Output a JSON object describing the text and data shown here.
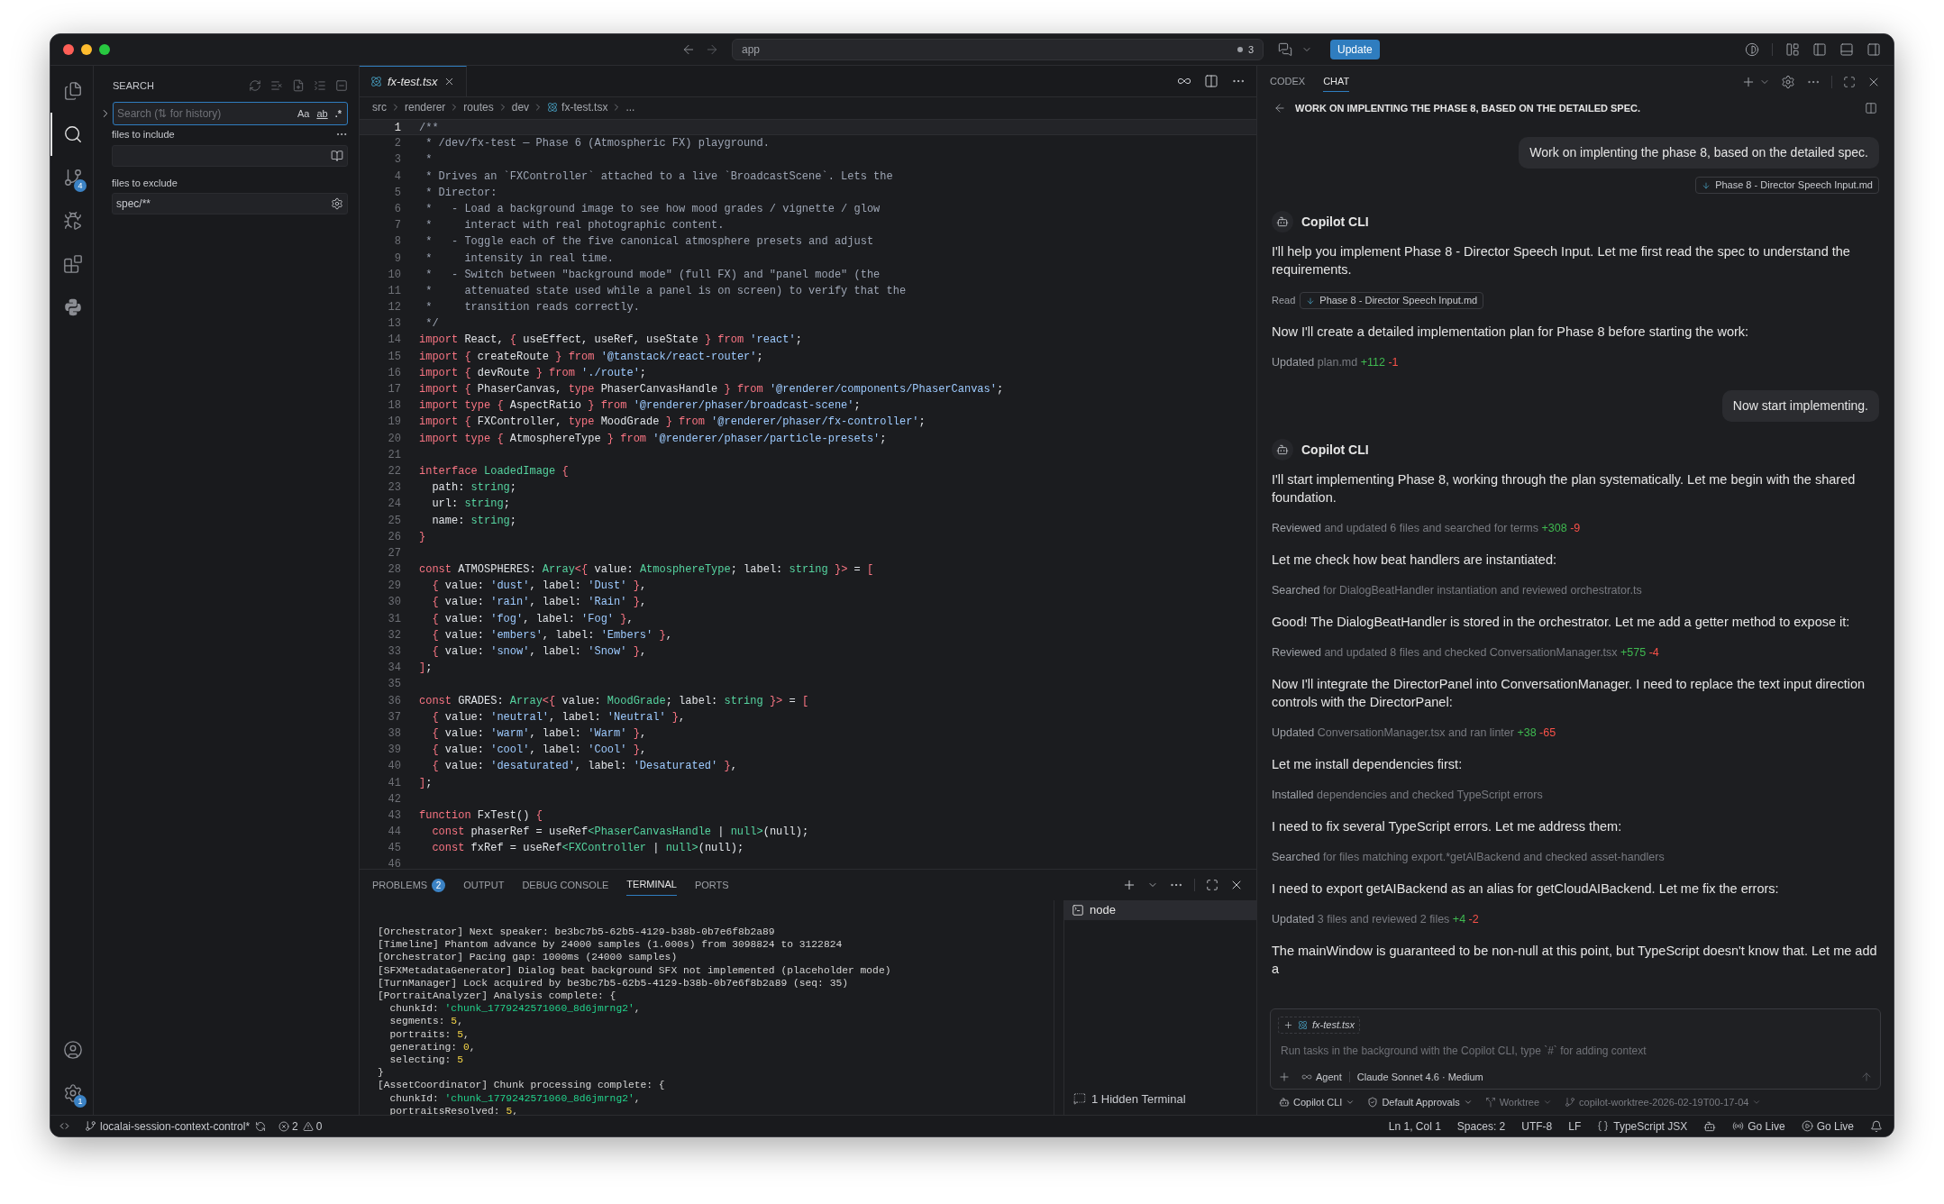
{
  "title_bar": {
    "command_center": "app",
    "notifications": "3",
    "update_button": "Update"
  },
  "activity_bar": {
    "items": [
      {
        "kind": "files",
        "selected": false
      },
      {
        "kind": "search",
        "selected": true
      },
      {
        "kind": "source_control",
        "selected": false,
        "badge": "4"
      },
      {
        "kind": "run_debug",
        "selected": false
      },
      {
        "kind": "extensions",
        "selected": false
      },
      {
        "kind": "python",
        "selected": false
      }
    ],
    "bottom": [
      {
        "kind": "accounts"
      },
      {
        "kind": "settings",
        "badge": "1"
      }
    ]
  },
  "sidebar": {
    "title": "SEARCH",
    "search": {
      "placeholder": "Search (⇅ for history)",
      "options": [
        {
          "label": "Aa",
          "kind": "case",
          "selected": false
        },
        {
          "label": "ab",
          "kind": "word",
          "selected": false
        },
        {
          "label": ".*",
          "kind": "regex",
          "selected": false
        }
      ]
    },
    "include": {
      "label": "files to include"
    },
    "exclude": {
      "label": "files to exclude",
      "value": "spec/**"
    }
  },
  "editor": {
    "tabs": [
      {
        "label": "fx-test.tsx",
        "selected": true,
        "preview": true
      }
    ],
    "breadcrumbs": [
      {
        "text": "src",
        "kind": "folder"
      },
      {
        "text": "renderer",
        "kind": "folder"
      },
      {
        "text": "routes",
        "kind": "folder"
      },
      {
        "text": "dev",
        "kind": "folder"
      },
      {
        "text": "fx-test.tsx",
        "kind": "file"
      },
      {
        "text": "...",
        "kind": "more"
      }
    ],
    "lines": [
      {
        "no": "1",
        "current": true,
        "tokens": [
          {
            "kind": "comment",
            "text": "/**"
          }
        ]
      },
      {
        "no": "2",
        "current": false,
        "tokens": [
          {
            "kind": "comment",
            "text": " * /dev/fx-test — Phase 6 (Atmospheric FX) playground."
          }
        ]
      },
      {
        "no": "3",
        "current": false,
        "tokens": [
          {
            "kind": "comment",
            "text": " *"
          }
        ]
      },
      {
        "no": "4",
        "current": false,
        "tokens": [
          {
            "kind": "comment",
            "text": " * Drives an `FXController` attached to a live `BroadcastScene`. Lets the"
          }
        ]
      },
      {
        "no": "5",
        "current": false,
        "tokens": [
          {
            "kind": "comment",
            "text": " * Director:"
          }
        ]
      },
      {
        "no": "6",
        "current": false,
        "tokens": [
          {
            "kind": "comment",
            "text": " *   - Load a background image to see how mood grades / vignette / glow"
          }
        ]
      },
      {
        "no": "7",
        "current": false,
        "tokens": [
          {
            "kind": "comment",
            "text": " *     interact with real photographic content."
          }
        ]
      },
      {
        "no": "8",
        "current": false,
        "tokens": [
          {
            "kind": "comment",
            "text": " *   - Toggle each of the five canonical atmosphere presets and adjust"
          }
        ]
      },
      {
        "no": "9",
        "current": false,
        "tokens": [
          {
            "kind": "comment",
            "text": " *     intensity in real time."
          }
        ]
      },
      {
        "no": "10",
        "current": false,
        "tokens": [
          {
            "kind": "comment",
            "text": " *   - Switch between \"background mode\" (full FX) and \"panel mode\" (the"
          }
        ]
      },
      {
        "no": "11",
        "current": false,
        "tokens": [
          {
            "kind": "comment",
            "text": " *     attenuated state used while a panel is on screen) to verify that the"
          }
        ]
      },
      {
        "no": "12",
        "current": false,
        "tokens": [
          {
            "kind": "comment",
            "text": " *     transition reads correctly."
          }
        ]
      },
      {
        "no": "13",
        "current": false,
        "tokens": [
          {
            "kind": "comment",
            "text": " */"
          }
        ]
      },
      {
        "no": "14",
        "current": false,
        "tokens": [
          {
            "kind": "keyword",
            "text": "import"
          },
          {
            "kind": "plain",
            "text": " React, "
          },
          {
            "kind": "keyword",
            "text": "{"
          },
          {
            "kind": "plain",
            "text": " useEffect, useRef, useState "
          },
          {
            "kind": "keyword",
            "text": "} from "
          },
          {
            "kind": "string",
            "text": "'react'"
          },
          {
            "kind": "plain",
            "text": ";"
          }
        ]
      },
      {
        "no": "15",
        "current": false,
        "tokens": [
          {
            "kind": "keyword",
            "text": "import {"
          },
          {
            "kind": "plain",
            "text": " createRoute "
          },
          {
            "kind": "keyword",
            "text": "} from "
          },
          {
            "kind": "string",
            "text": "'@tanstack/react-router'"
          },
          {
            "kind": "plain",
            "text": ";"
          }
        ]
      },
      {
        "no": "16",
        "current": false,
        "tokens": [
          {
            "kind": "keyword",
            "text": "import {"
          },
          {
            "kind": "plain",
            "text": " devRoute "
          },
          {
            "kind": "keyword",
            "text": "} from "
          },
          {
            "kind": "string",
            "text": "'./route'"
          },
          {
            "kind": "plain",
            "text": ";"
          }
        ]
      },
      {
        "no": "17",
        "current": false,
        "tokens": [
          {
            "kind": "keyword",
            "text": "import {"
          },
          {
            "kind": "plain",
            "text": " PhaserCanvas, "
          },
          {
            "kind": "keyword",
            "text": "type"
          },
          {
            "kind": "plain",
            "text": " PhaserCanvasHandle "
          },
          {
            "kind": "keyword",
            "text": "} from "
          },
          {
            "kind": "string",
            "text": "'@renderer/components/PhaserCanvas'"
          },
          {
            "kind": "plain",
            "text": ";"
          }
        ]
      },
      {
        "no": "18",
        "current": false,
        "tokens": [
          {
            "kind": "keyword",
            "text": "import type {"
          },
          {
            "kind": "plain",
            "text": " AspectRatio "
          },
          {
            "kind": "keyword",
            "text": "} from "
          },
          {
            "kind": "string",
            "text": "'@renderer/phaser/broadcast-scene'"
          },
          {
            "kind": "plain",
            "text": ";"
          }
        ]
      },
      {
        "no": "19",
        "current": false,
        "tokens": [
          {
            "kind": "keyword",
            "text": "import {"
          },
          {
            "kind": "plain",
            "text": " FXController, "
          },
          {
            "kind": "keyword",
            "text": "type"
          },
          {
            "kind": "plain",
            "text": " MoodGrade "
          },
          {
            "kind": "keyword",
            "text": "} from "
          },
          {
            "kind": "string",
            "text": "'@renderer/phaser/fx-controller'"
          },
          {
            "kind": "plain",
            "text": ";"
          }
        ]
      },
      {
        "no": "20",
        "current": false,
        "tokens": [
          {
            "kind": "keyword",
            "text": "import type {"
          },
          {
            "kind": "plain",
            "text": " AtmosphereType "
          },
          {
            "kind": "keyword",
            "text": "} from "
          },
          {
            "kind": "string",
            "text": "'@renderer/phaser/particle-presets'"
          },
          {
            "kind": "plain",
            "text": ";"
          }
        ]
      },
      {
        "no": "21",
        "current": false
      },
      {
        "no": "22",
        "current": false,
        "tokens": [
          {
            "kind": "keyword",
            "text": "interface "
          },
          {
            "kind": "type",
            "text": "LoadedImage"
          },
          {
            "kind": "keyword",
            "text": " {"
          }
        ]
      },
      {
        "no": "23",
        "current": false,
        "tokens": [
          {
            "kind": "plain",
            "text": "  path: "
          },
          {
            "kind": "type",
            "text": "string"
          },
          {
            "kind": "plain",
            "text": ";"
          }
        ]
      },
      {
        "no": "24",
        "current": false,
        "tokens": [
          {
            "kind": "plain",
            "text": "  url: "
          },
          {
            "kind": "type",
            "text": "string"
          },
          {
            "kind": "plain",
            "text": ";"
          }
        ]
      },
      {
        "no": "25",
        "current": false,
        "tokens": [
          {
            "kind": "plain",
            "text": "  name: "
          },
          {
            "kind": "type",
            "text": "string"
          },
          {
            "kind": "plain",
            "text": ";"
          }
        ]
      },
      {
        "no": "26",
        "current": false,
        "tokens": [
          {
            "kind": "keyword",
            "text": "}"
          }
        ]
      },
      {
        "no": "27",
        "current": false
      },
      {
        "no": "28",
        "current": false,
        "tokens": [
          {
            "kind": "keyword",
            "text": "const "
          },
          {
            "kind": "plain",
            "text": "ATMOSPHERES: "
          },
          {
            "kind": "type",
            "text": "Array"
          },
          {
            "kind": "keyword",
            "text": "<{"
          },
          {
            "kind": "plain",
            "text": " value: "
          },
          {
            "kind": "type",
            "text": "AtmosphereType"
          },
          {
            "kind": "plain",
            "text": "; label: "
          },
          {
            "kind": "type",
            "text": "string"
          },
          {
            "kind": "keyword",
            "text": " }>"
          },
          {
            "kind": "plain",
            "text": " = "
          },
          {
            "kind": "keyword",
            "text": "["
          }
        ]
      },
      {
        "no": "29",
        "current": false,
        "tokens": [
          {
            "kind": "keyword",
            "text": "  {"
          },
          {
            "kind": "plain",
            "text": " value: "
          },
          {
            "kind": "string",
            "text": "'dust'"
          },
          {
            "kind": "plain",
            "text": ", label: "
          },
          {
            "kind": "string",
            "text": "'Dust'"
          },
          {
            "kind": "keyword",
            "text": " }"
          },
          {
            "kind": "plain",
            "text": ","
          }
        ]
      },
      {
        "no": "30",
        "current": false,
        "tokens": [
          {
            "kind": "keyword",
            "text": "  {"
          },
          {
            "kind": "plain",
            "text": " value: "
          },
          {
            "kind": "string",
            "text": "'rain'"
          },
          {
            "kind": "plain",
            "text": ", label: "
          },
          {
            "kind": "string",
            "text": "'Rain'"
          },
          {
            "kind": "keyword",
            "text": " }"
          },
          {
            "kind": "plain",
            "text": ","
          }
        ]
      },
      {
        "no": "31",
        "current": false,
        "tokens": [
          {
            "kind": "keyword",
            "text": "  {"
          },
          {
            "kind": "plain",
            "text": " value: "
          },
          {
            "kind": "string",
            "text": "'fog'"
          },
          {
            "kind": "plain",
            "text": ", label: "
          },
          {
            "kind": "string",
            "text": "'Fog'"
          },
          {
            "kind": "keyword",
            "text": " }"
          },
          {
            "kind": "plain",
            "text": ","
          }
        ]
      },
      {
        "no": "32",
        "current": false,
        "tokens": [
          {
            "kind": "keyword",
            "text": "  {"
          },
          {
            "kind": "plain",
            "text": " value: "
          },
          {
            "kind": "string",
            "text": "'embers'"
          },
          {
            "kind": "plain",
            "text": ", label: "
          },
          {
            "kind": "string",
            "text": "'Embers'"
          },
          {
            "kind": "keyword",
            "text": " }"
          },
          {
            "kind": "plain",
            "text": ","
          }
        ]
      },
      {
        "no": "33",
        "current": false,
        "tokens": [
          {
            "kind": "keyword",
            "text": "  {"
          },
          {
            "kind": "plain",
            "text": " value: "
          },
          {
            "kind": "string",
            "text": "'snow'"
          },
          {
            "kind": "plain",
            "text": ", label: "
          },
          {
            "kind": "string",
            "text": "'Snow'"
          },
          {
            "kind": "keyword",
            "text": " }"
          },
          {
            "kind": "plain",
            "text": ","
          }
        ]
      },
      {
        "no": "34",
        "current": false,
        "tokens": [
          {
            "kind": "keyword",
            "text": "]"
          },
          {
            "kind": "plain",
            "text": ";"
          }
        ]
      },
      {
        "no": "35",
        "current": false
      },
      {
        "no": "36",
        "current": false,
        "tokens": [
          {
            "kind": "keyword",
            "text": "const "
          },
          {
            "kind": "plain",
            "text": "GRADES: "
          },
          {
            "kind": "type",
            "text": "Array"
          },
          {
            "kind": "keyword",
            "text": "<{"
          },
          {
            "kind": "plain",
            "text": " value: "
          },
          {
            "kind": "type",
            "text": "MoodGrade"
          },
          {
            "kind": "plain",
            "text": "; label: "
          },
          {
            "kind": "type",
            "text": "string"
          },
          {
            "kind": "keyword",
            "text": " }>"
          },
          {
            "kind": "plain",
            "text": " = "
          },
          {
            "kind": "keyword",
            "text": "["
          }
        ]
      },
      {
        "no": "37",
        "current": false,
        "tokens": [
          {
            "kind": "keyword",
            "text": "  {"
          },
          {
            "kind": "plain",
            "text": " value: "
          },
          {
            "kind": "string",
            "text": "'neutral'"
          },
          {
            "kind": "plain",
            "text": ", label: "
          },
          {
            "kind": "string",
            "text": "'Neutral'"
          },
          {
            "kind": "keyword",
            "text": " }"
          },
          {
            "kind": "plain",
            "text": ","
          }
        ]
      },
      {
        "no": "38",
        "current": false,
        "tokens": [
          {
            "kind": "keyword",
            "text": "  {"
          },
          {
            "kind": "plain",
            "text": " value: "
          },
          {
            "kind": "string",
            "text": "'warm'"
          },
          {
            "kind": "plain",
            "text": ", label: "
          },
          {
            "kind": "string",
            "text": "'Warm'"
          },
          {
            "kind": "keyword",
            "text": " }"
          },
          {
            "kind": "plain",
            "text": ","
          }
        ]
      },
      {
        "no": "39",
        "current": false,
        "tokens": [
          {
            "kind": "keyword",
            "text": "  {"
          },
          {
            "kind": "plain",
            "text": " value: "
          },
          {
            "kind": "string",
            "text": "'cool'"
          },
          {
            "kind": "plain",
            "text": ", label: "
          },
          {
            "kind": "string",
            "text": "'Cool'"
          },
          {
            "kind": "keyword",
            "text": " }"
          },
          {
            "kind": "plain",
            "text": ","
          }
        ]
      },
      {
        "no": "40",
        "current": false,
        "tokens": [
          {
            "kind": "keyword",
            "text": "  {"
          },
          {
            "kind": "plain",
            "text": " value: "
          },
          {
            "kind": "string",
            "text": "'desaturated'"
          },
          {
            "kind": "plain",
            "text": ", label: "
          },
          {
            "kind": "string",
            "text": "'Desaturated'"
          },
          {
            "kind": "keyword",
            "text": " }"
          },
          {
            "kind": "plain",
            "text": ","
          }
        ]
      },
      {
        "no": "41",
        "current": false,
        "tokens": [
          {
            "kind": "keyword",
            "text": "]"
          },
          {
            "kind": "plain",
            "text": ";"
          }
        ]
      },
      {
        "no": "42",
        "current": false
      },
      {
        "no": "43",
        "current": false,
        "tokens": [
          {
            "kind": "keyword",
            "text": "function "
          },
          {
            "kind": "plain",
            "text": "FxTest() "
          },
          {
            "kind": "keyword",
            "text": "{"
          }
        ]
      },
      {
        "no": "44",
        "current": false,
        "tokens": [
          {
            "kind": "keyword",
            "text": "  const "
          },
          {
            "kind": "plain",
            "text": "phaserRef = useRef"
          },
          {
            "kind": "type",
            "text": "<PhaserCanvasHandle"
          },
          {
            "kind": "plain",
            "text": " | "
          },
          {
            "kind": "type",
            "text": "null>"
          },
          {
            "kind": "plain",
            "text": "(null);"
          }
        ]
      },
      {
        "no": "45",
        "current": false,
        "tokens": [
          {
            "kind": "keyword",
            "text": "  const "
          },
          {
            "kind": "plain",
            "text": "fxRef = useRef"
          },
          {
            "kind": "type",
            "text": "<FXController"
          },
          {
            "kind": "plain",
            "text": " | "
          },
          {
            "kind": "type",
            "text": "null>"
          },
          {
            "kind": "plain",
            "text": "(null);"
          }
        ]
      },
      {
        "no": "46",
        "current": false
      }
    ]
  },
  "panel": {
    "tabs": [
      {
        "label": "PROBLEMS",
        "selected": false,
        "badge": "2"
      },
      {
        "label": "OUTPUT",
        "selected": false
      },
      {
        "label": "DEBUG CONSOLE",
        "selected": false
      },
      {
        "label": "TERMINAL",
        "selected": true
      },
      {
        "label": "PORTS",
        "selected": false
      }
    ],
    "terminal": {
      "lines": [
        [
          {
            "kind": "plain",
            "text": "[Orchestrator] Next speaker: be3bc7b5-62b5-4129-b38b-0b7e6f8b2a89"
          }
        ],
        [
          {
            "kind": "plain",
            "text": "[Timeline] Phantom advance by 24000 samples (1.000s) from 3098824 to 3122824"
          }
        ],
        [
          {
            "kind": "plain",
            "text": "[Orchestrator] Pacing gap: 1000ms (24000 samples)"
          }
        ],
        [
          {
            "kind": "plain",
            "text": "[SFXMetadataGenerator] Dialog beat background SFX not implemented (placeholder mode)"
          }
        ],
        [
          {
            "kind": "plain",
            "text": "[TurnManager] Lock acquired by be3bc7b5-62b5-4129-b38b-0b7e6f8b2a89 (seq: 35)"
          }
        ],
        [
          {
            "kind": "plain",
            "text": "[PortraitAnalyzer] Analysis complete: {"
          }
        ],
        [
          {
            "kind": "plain",
            "text": "  chunkId: "
          },
          {
            "kind": "string",
            "text": "'chunk_1779242571060_8d6jmrng2'"
          },
          {
            "kind": "plain",
            "text": ","
          }
        ],
        [
          {
            "kind": "plain",
            "text": "  segments: "
          },
          {
            "kind": "number",
            "text": "5"
          },
          {
            "kind": "plain",
            "text": ","
          }
        ],
        [
          {
            "kind": "plain",
            "text": "  portraits: "
          },
          {
            "kind": "number",
            "text": "5"
          },
          {
            "kind": "plain",
            "text": ","
          }
        ],
        [
          {
            "kind": "plain",
            "text": "  generating: "
          },
          {
            "kind": "number",
            "text": "0"
          },
          {
            "kind": "plain",
            "text": ","
          }
        ],
        [
          {
            "kind": "plain",
            "text": "  selecting: "
          },
          {
            "kind": "number",
            "text": "5"
          }
        ],
        [
          {
            "kind": "plain",
            "text": "}"
          }
        ],
        [
          {
            "kind": "plain",
            "text": "[AssetCoordinator] Chunk processing complete: {"
          }
        ],
        [
          {
            "kind": "plain",
            "text": "  chunkId: "
          },
          {
            "kind": "string",
            "text": "'chunk_1779242571060_8d6jmrng2'"
          },
          {
            "kind": "plain",
            "text": ","
          }
        ],
        [
          {
            "kind": "plain",
            "text": "  portraitsResolved: "
          },
          {
            "kind": "number",
            "text": "5"
          },
          {
            "kind": "plain",
            "text": ","
          }
        ]
      ]
    },
    "terminals": [
      {
        "label": "node",
        "selected": true
      }
    ],
    "hidden_terminals": "1 Hidden Terminal"
  },
  "chat": {
    "tabs": [
      {
        "label": "CODEX",
        "selected": false
      },
      {
        "label": "CHAT",
        "selected": true
      }
    ],
    "title": "WORK ON IMPLENTING THE PHASE 8, BASED ON THE DETAILED SPEC.",
    "items": [
      {
        "kind": "user",
        "text": "Work on implenting the phase 8, based on the detailed spec."
      },
      {
        "kind": "attachment",
        "text": "Phase 8 - Director Speech Input.md"
      },
      {
        "kind": "agent",
        "text": "Copilot CLI"
      },
      {
        "kind": "text",
        "text": "I'll help you implement Phase 8 - Director Speech Input. Let me first read the spec to understand the requirements."
      },
      {
        "kind": "read",
        "verb": "Read",
        "text": "Phase 8 - Director Speech Input.md"
      },
      {
        "kind": "text",
        "text": "Now I'll create a detailed implementation plan for Phase 8 before starting the work:"
      },
      {
        "kind": "action",
        "verb": "Updated",
        "text": "plan.md",
        "added": "+112",
        "removed": "-1"
      },
      {
        "kind": "user",
        "text": "Now start implementing."
      },
      {
        "kind": "agent",
        "text": "Copilot CLI"
      },
      {
        "kind": "text",
        "text": "I'll start implementing Phase 8, working through the plan systematically. Let me begin with the shared foundation."
      },
      {
        "kind": "action",
        "verb": "Reviewed",
        "text": "and updated 6 files and searched for terms",
        "added": "+308",
        "removed": "-9"
      },
      {
        "kind": "text",
        "text": "Let me check how beat handlers are instantiated:"
      },
      {
        "kind": "action",
        "verb": "Searched",
        "text": "for DialogBeatHandler instantiation and reviewed orchestrator.ts"
      },
      {
        "kind": "text",
        "text": "Good! The DialogBeatHandler is stored in the orchestrator. Let me add a getter method to expose it:"
      },
      {
        "kind": "action",
        "verb": "Reviewed",
        "text": "and updated 8 files and checked ConversationManager.tsx",
        "added": "+575",
        "removed": "-4"
      },
      {
        "kind": "text",
        "text": "Now I'll integrate the DirectorPanel into ConversationManager. I need to replace the text input direction controls with the DirectorPanel:"
      },
      {
        "kind": "action",
        "verb": "Updated",
        "text": "ConversationManager.tsx and ran linter",
        "added": "+38",
        "removed": "-65"
      },
      {
        "kind": "text",
        "text": "Let me install dependencies first:"
      },
      {
        "kind": "action",
        "verb": "Installed",
        "text": "dependencies and checked TypeScript errors"
      },
      {
        "kind": "text",
        "text": "I need to fix several TypeScript errors. Let me address them:"
      },
      {
        "kind": "action",
        "verb": "Searched",
        "text": "for files matching export.*getAIBackend and checked asset-handlers"
      },
      {
        "kind": "text",
        "text": "I need to export getAIBackend as an alias for getCloudAIBackend. Let me fix the errors:"
      },
      {
        "kind": "action",
        "verb": "Updated",
        "text": "3 files and reviewed 2 files",
        "added": "+4",
        "removed": "-2"
      },
      {
        "kind": "text",
        "text": "The mainWindow is guaranteed to be non-null at this point, but TypeScript doesn't know that. Let me add a"
      }
    ],
    "input": {
      "context": "fx-test.tsx",
      "placeholder": "Run tasks in the background with the Copilot CLI, type `#` for adding context",
      "mode": "Agent",
      "model": "Claude Sonnet 4.6 · Medium"
    },
    "options": [
      {
        "kind": "agent",
        "label": "Copilot CLI"
      },
      {
        "kind": "approvals",
        "label": "Default Approvals"
      },
      {
        "kind": "worktree",
        "label": "Worktree"
      },
      {
        "kind": "branch",
        "label": "copilot-worktree-2026-02-19T00-17-04"
      }
    ]
  },
  "status_bar": {
    "branch": "localai-session-context-control*",
    "errors": "2",
    "warnings": "0",
    "position": "Ln 1, Col 1",
    "indent": "Spaces: 2",
    "encoding": "UTF-8",
    "eol": "LF",
    "language": "TypeScript JSX",
    "live": [
      "Go Live",
      "Go Live"
    ]
  }
}
